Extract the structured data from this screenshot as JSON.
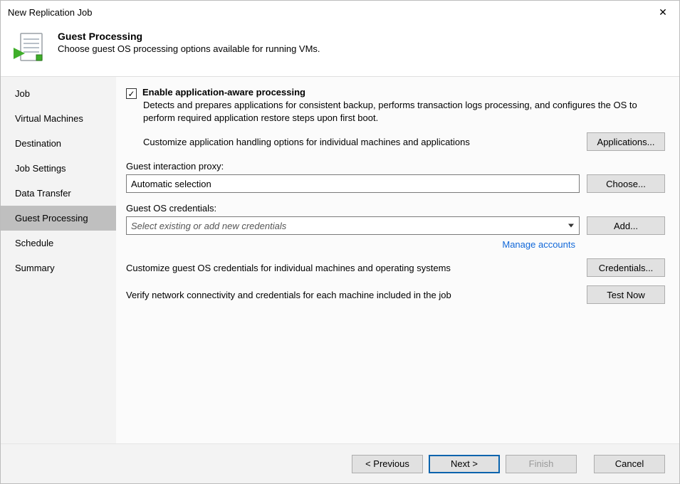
{
  "window": {
    "title": "New Replication Job"
  },
  "header": {
    "heading": "Guest Processing",
    "subheading": "Choose guest OS processing options available for running VMs."
  },
  "sidebar": {
    "items": [
      {
        "label": "Job"
      },
      {
        "label": "Virtual Machines"
      },
      {
        "label": "Destination"
      },
      {
        "label": "Job Settings"
      },
      {
        "label": "Data Transfer"
      },
      {
        "label": "Guest Processing",
        "selected": true
      },
      {
        "label": "Schedule"
      },
      {
        "label": "Summary"
      }
    ]
  },
  "main": {
    "enable_checkbox_label": "Enable application-aware processing",
    "enable_checked": true,
    "enable_desc": "Detects and prepares applications for consistent backup, performs transaction logs processing, and configures the OS to perform required application restore steps upon first boot.",
    "apps_row_text": "Customize application handling options for individual machines and applications",
    "apps_button": "Applications...",
    "proxy_label": "Guest interaction proxy:",
    "proxy_value": "Automatic selection",
    "proxy_button": "Choose...",
    "creds_label": "Guest OS credentials:",
    "creds_placeholder": "Select existing or add new credentials",
    "creds_button": "Add...",
    "manage_link": "Manage accounts",
    "cust_creds_text": "Customize guest OS credentials for individual machines and operating systems",
    "cust_creds_button": "Credentials...",
    "test_text": "Verify network connectivity and credentials for each machine included in the job",
    "test_button": "Test Now"
  },
  "footer": {
    "previous": "< Previous",
    "next": "Next >",
    "finish": "Finish",
    "cancel": "Cancel"
  }
}
